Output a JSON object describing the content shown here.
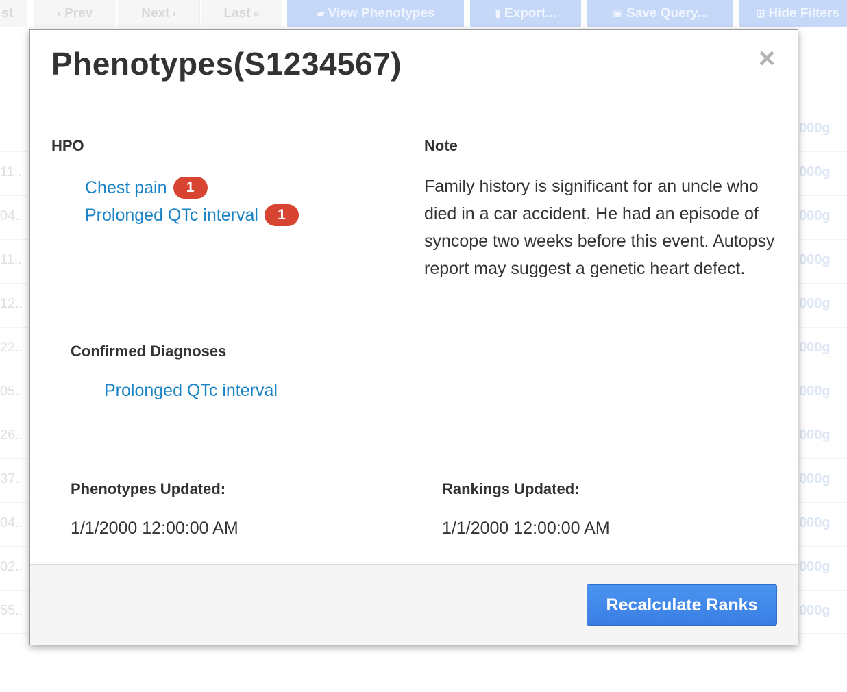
{
  "toolbar": {
    "first_partial": "st",
    "prev_label": "Prev",
    "next_label": "Next",
    "last_label": "Last",
    "view_phenotypes_label": "View Phenotypes",
    "export_label": "Export...",
    "save_query_label": "Save Query...",
    "hide_filters_label": "Hide Filters"
  },
  "background_rows": [
    {
      "left": "",
      "right": "000g"
    },
    {
      "left": "11..",
      "right": "000g"
    },
    {
      "left": "04..",
      "right": "000g"
    },
    {
      "left": "11..",
      "right": "000g"
    },
    {
      "left": "12..",
      "right": "000g"
    },
    {
      "left": "22..",
      "right": "000g"
    },
    {
      "left": "05..",
      "right": "000g"
    },
    {
      "left": "26..",
      "right": "000g"
    },
    {
      "left": "37..",
      "right": "000g"
    },
    {
      "left": "04..",
      "right": "000g"
    },
    {
      "left": "02..",
      "right": "000g"
    },
    {
      "left": "55..",
      "right": "000g"
    }
  ],
  "modal": {
    "title": "Phenotypes(S1234567)",
    "close_symbol": "×",
    "hpo_label": "HPO",
    "hpo_items": [
      {
        "label": "Chest pain",
        "count": "1"
      },
      {
        "label": "Prolonged QTc interval",
        "count": "1"
      }
    ],
    "note_label": "Note",
    "note_text": "Family history is significant for an uncle who died in a car accident. He had an episode of syncope two weeks before this event. Autopsy report may suggest a genetic heart defect.",
    "confirmed_label": "Confirmed Diagnoses",
    "confirmed_items": [
      "Prolonged QTc interval"
    ],
    "phenotypes_updated_label": "Phenotypes Updated:",
    "phenotypes_updated_value": "1/1/2000 12:00:00 AM",
    "rankings_updated_label": "Rankings Updated:",
    "rankings_updated_value": "1/1/2000 12:00:00 AM",
    "recalculate_label": "Recalculate Ranks"
  }
}
